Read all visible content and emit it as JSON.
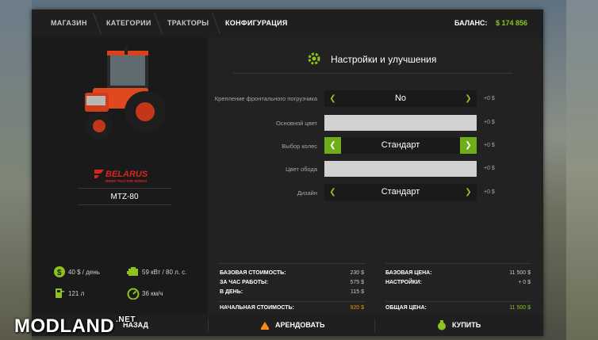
{
  "breadcrumbs": [
    "МАГАЗИН",
    "КАТЕГОРИИ",
    "ТРАКТОРЫ",
    "КОНФИГУРАЦИЯ"
  ],
  "balance": {
    "label": "БАЛАНС:",
    "value": "$ 174 856"
  },
  "vehicle": {
    "brand": "BELARUS",
    "brand_sub": "MINSK TRACTOR WORKS",
    "model": "MTZ-80",
    "specs": {
      "daily_cost": "40 $ / день",
      "power": "59 кВт / 80 л. с.",
      "fuel": "121 л",
      "speed": "36 км/ч"
    }
  },
  "config": {
    "title": "Настройки и улучшения",
    "options": [
      {
        "label": "Крепление фронтального погрузчика",
        "value": "No",
        "price": "+0 $"
      },
      {
        "label": "Основной цвет",
        "value": "",
        "price": "+0 $"
      },
      {
        "label": "Выбор колес",
        "value": "Стандарт",
        "price": "+0 $"
      },
      {
        "label": "Цвет обода",
        "value": "",
        "price": "+0 $"
      },
      {
        "label": "Дизайн",
        "value": "Стандарт",
        "price": "+0 $"
      }
    ]
  },
  "costs": {
    "base_cost_label": "БАЗОВАЯ СТОИМОСТЬ:",
    "base_cost": "230 $",
    "per_hour_label": "ЗА ЧАС РАБОТЫ:",
    "per_hour": "575 $",
    "per_day_label": "В ДЕНЬ:",
    "per_day": "115 $",
    "initial_cost_label": "НАЧАЛЬНАЯ СТОИМОСТЬ:",
    "initial_cost": "920 $",
    "base_price_label": "БАЗОВАЯ ЦЕНА:",
    "base_price": "11 500 $",
    "settings_label": "НАСТРОЙКИ:",
    "settings": "+ 0 $",
    "total_price_label": "ОБЩАЯ ЦЕНА:",
    "total_price": "11 500 $"
  },
  "actions": {
    "back": "НАЗАД",
    "lease": "АРЕНДОВАТЬ",
    "buy": "КУПИТЬ"
  },
  "watermark": "MODLAND",
  "watermark_suffix": ".NET",
  "colors": {
    "accent": "#8ec21e",
    "orange": "#ff8c1a",
    "panel": "#222222",
    "brand_red": "#d7261e"
  }
}
